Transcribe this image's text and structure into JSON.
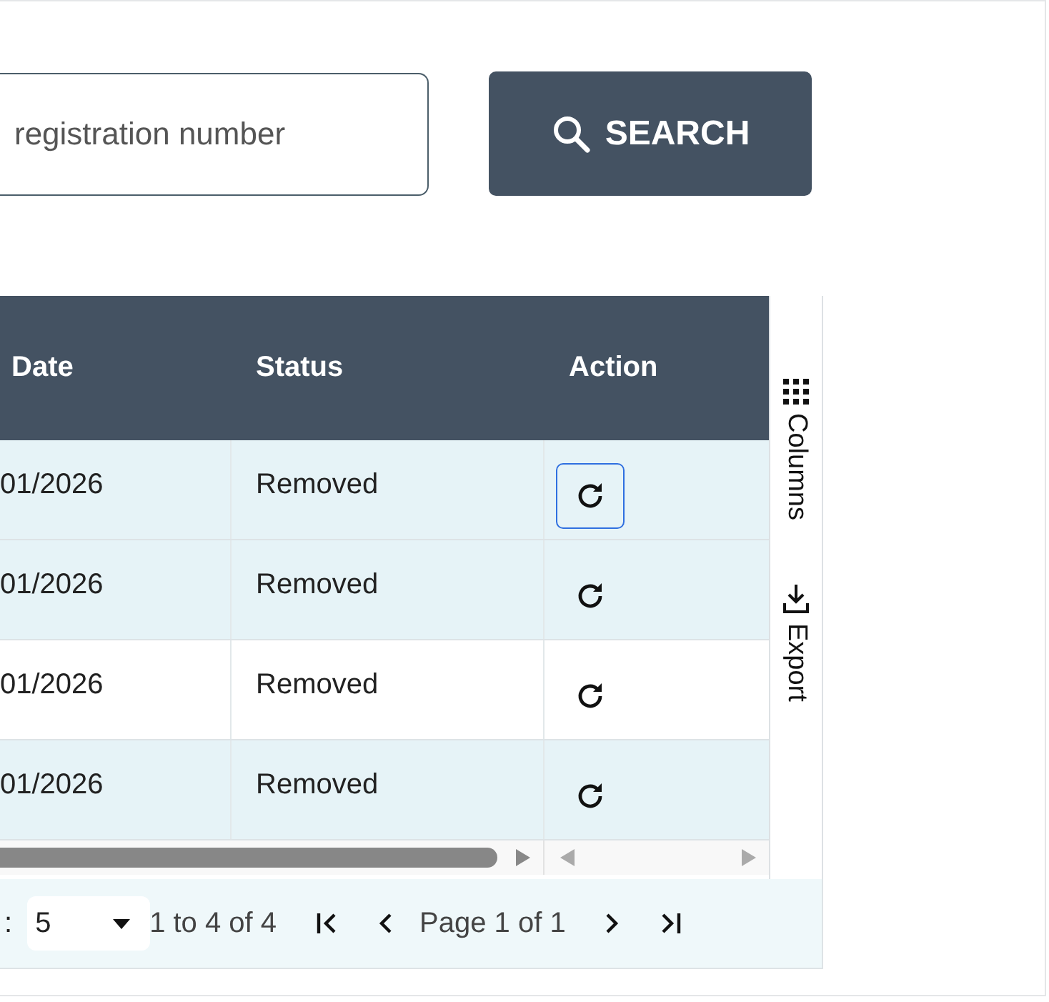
{
  "search": {
    "placeholder": "registration number",
    "button": "SEARCH"
  },
  "table": {
    "columns": [
      "Date",
      "Status",
      "Action"
    ],
    "rows": [
      {
        "date": "01/2026",
        "status": "Removed",
        "shaded": true,
        "focused": true
      },
      {
        "date": "01/2026",
        "status": "Removed",
        "shaded": true,
        "focused": false
      },
      {
        "date": "01/2026",
        "status": "Removed",
        "shaded": false,
        "focused": false
      },
      {
        "date": "01/2026",
        "status": "Removed",
        "shaded": true,
        "focused": false
      }
    ]
  },
  "side_panel": {
    "tabs": [
      "Columns",
      "Export"
    ]
  },
  "pagination": {
    "page_size_label": ":",
    "page_size": "5",
    "range": "1 to 4 of 4",
    "page": "Page 1 of 1"
  }
}
